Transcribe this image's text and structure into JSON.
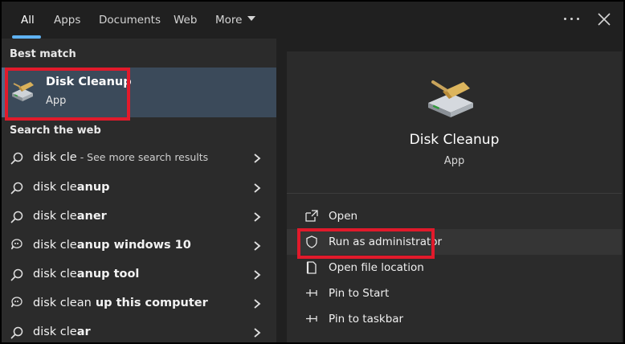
{
  "tabs": [
    {
      "label": "All",
      "active": true
    },
    {
      "label": "Apps",
      "active": false
    },
    {
      "label": "Documents",
      "active": false
    },
    {
      "label": "Web",
      "active": false
    },
    {
      "label": "More",
      "active": false
    }
  ],
  "topbar_icons": {
    "more_options": "ellipsis-icon",
    "close": "close-icon"
  },
  "best_match": {
    "heading": "Best match",
    "name_bold": "Disk Cle",
    "name_rest": "anup",
    "type": "App",
    "icon": "disk-cleanup-icon"
  },
  "search_web": {
    "heading": "Search the web",
    "items": [
      {
        "icon": "search-icon",
        "prefix": "disk cle",
        "bold": "",
        "hint": " - See more search results"
      },
      {
        "icon": "search-icon",
        "prefix": "disk cle",
        "bold": "anup",
        "hint": ""
      },
      {
        "icon": "search-icon",
        "prefix": "disk cle",
        "bold": "aner",
        "hint": ""
      },
      {
        "icon": "web-search-icon",
        "prefix": "disk cle",
        "bold": "anup windows 10",
        "hint": ""
      },
      {
        "icon": "search-icon",
        "prefix": "disk cle",
        "bold": "anup tool",
        "hint": ""
      },
      {
        "icon": "web-search-icon",
        "prefix": "disk clean",
        "bold": " up this computer",
        "hint": ""
      },
      {
        "icon": "search-icon",
        "prefix": "disk cle",
        "bold": "ar",
        "hint": ""
      }
    ]
  },
  "preview": {
    "title": "Disk Cleanup",
    "subtitle": "App",
    "icon": "disk-cleanup-icon",
    "actions": [
      {
        "label": "Open",
        "icon": "open-icon"
      },
      {
        "label": "Run as administrator",
        "icon": "shield-icon"
      },
      {
        "label": "Open file location",
        "icon": "file-location-icon"
      },
      {
        "label": "Pin to Start",
        "icon": "pin-icon"
      },
      {
        "label": "Pin to taskbar",
        "icon": "pin-icon"
      }
    ]
  },
  "colors": {
    "accent": "#5fb2f2",
    "highlight_box": "#e11a2b",
    "panel_bg": "#2b2b2b",
    "selected_bg": "#3b4a5a"
  }
}
